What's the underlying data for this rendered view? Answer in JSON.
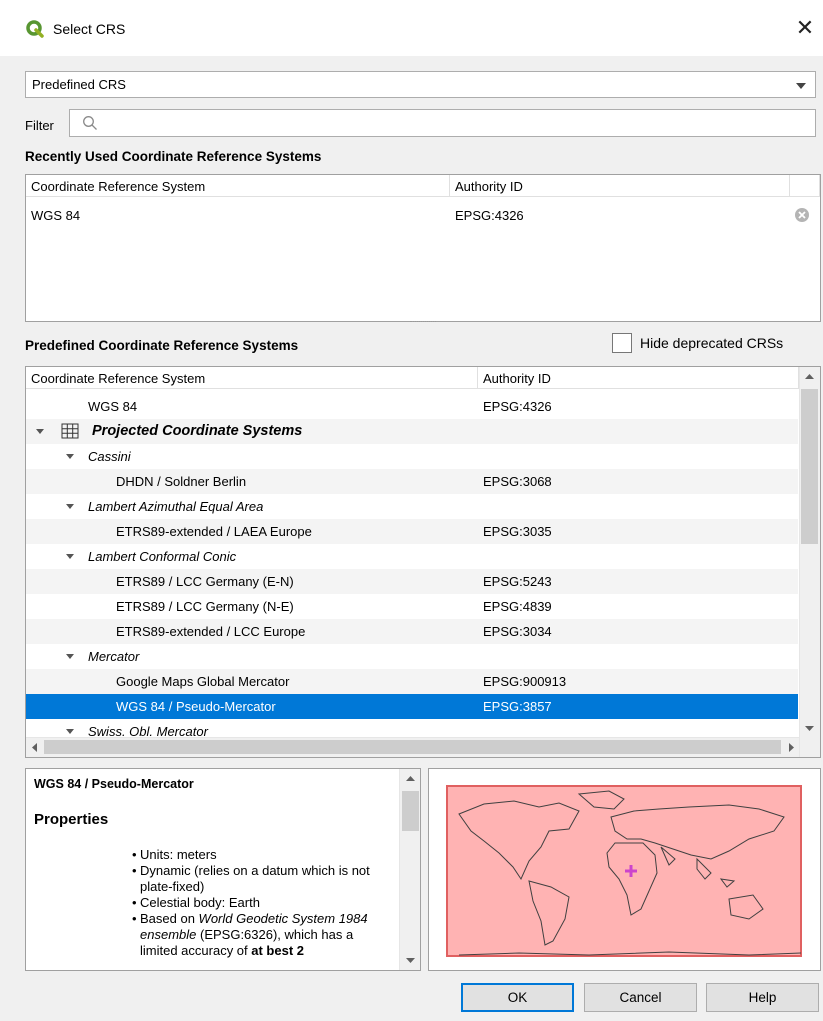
{
  "window": {
    "title": "Select CRS",
    "close_glyph": "✕"
  },
  "mode_select": {
    "selected": "Predefined CRS"
  },
  "filter": {
    "label": "Filter",
    "value": "",
    "placeholder": ""
  },
  "recent": {
    "title": "Recently Used Coordinate Reference Systems",
    "columns": [
      "Coordinate Reference System",
      "Authority ID"
    ],
    "rows": [
      {
        "name": "WGS 84",
        "id": "EPSG:4326"
      }
    ]
  },
  "predefined": {
    "title": "Predefined Coordinate Reference Systems",
    "hide_deprecated_label": "Hide deprecated CRSs",
    "hide_deprecated_checked": false,
    "columns": [
      "Coordinate Reference System",
      "Authority ID"
    ],
    "rows": [
      {
        "name": "WGS 84",
        "id": "EPSG:4326"
      },
      {
        "name": "Projected Coordinate Systems",
        "id": ""
      },
      {
        "name": "Cassini",
        "id": ""
      },
      {
        "name": "DHDN / Soldner Berlin",
        "id": "EPSG:3068"
      },
      {
        "name": "Lambert Azimuthal Equal Area",
        "id": ""
      },
      {
        "name": "ETRS89-extended / LAEA Europe",
        "id": "EPSG:3035"
      },
      {
        "name": "Lambert Conformal Conic",
        "id": ""
      },
      {
        "name": "ETRS89 / LCC Germany (E-N)",
        "id": "EPSG:5243"
      },
      {
        "name": "ETRS89 / LCC Germany (N-E)",
        "id": "EPSG:4839"
      },
      {
        "name": "ETRS89-extended / LCC Europe",
        "id": "EPSG:3034"
      },
      {
        "name": "Mercator",
        "id": ""
      },
      {
        "name": "Google Maps Global Mercator",
        "id": "EPSG:900913"
      },
      {
        "name": "WGS 84 / Pseudo-Mercator",
        "id": "EPSG:3857"
      },
      {
        "name": "Swiss. Obl. Mercator",
        "id": ""
      }
    ],
    "selected_index": 12
  },
  "details": {
    "heading": "WGS 84 / Pseudo-Mercator",
    "properties_heading": "Properties",
    "properties": [
      "Units: meters",
      "Dynamic (relies on a datum which is not plate-fixed)",
      "Celestial body: Earth"
    ],
    "based_on_prefix": "Based on ",
    "based_on_name": "World Geodetic System 1984 ensemble",
    "based_on_suffix": " (EPSG:6326), which has a limited accuracy of ",
    "accuracy_bold": "at best 2"
  },
  "buttons": {
    "ok": "OK",
    "cancel": "Cancel",
    "help": "Help"
  },
  "icons": {
    "logo": "qgis-logo-icon",
    "search": "search-icon",
    "remove": "remove-circle-icon",
    "grid": "grid-icon",
    "expand": "chevron-down-icon",
    "crosshair": "crosshair-icon"
  },
  "colors": {
    "selection": "#0078d7",
    "extent_fill": "#ffb3b3",
    "extent_border": "#e06060",
    "crosshair": "#cc44cc"
  }
}
